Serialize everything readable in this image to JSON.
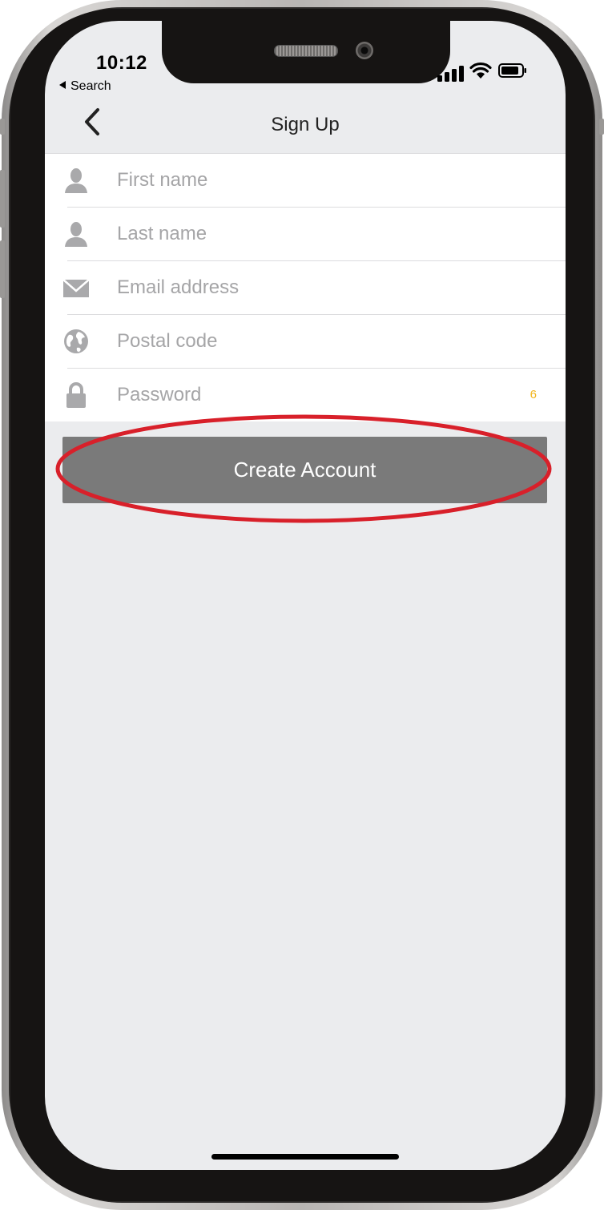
{
  "status_bar": {
    "time": "10:12",
    "back_app_label": "Search",
    "icons": [
      "cellular-signal-icon",
      "wifi-icon",
      "battery-icon"
    ]
  },
  "nav": {
    "title": "Sign Up",
    "back_icon": "chevron-left-icon"
  },
  "form": {
    "fields": [
      {
        "icon": "person-icon",
        "placeholder": "First name",
        "value": ""
      },
      {
        "icon": "person-icon",
        "placeholder": "Last name",
        "value": ""
      },
      {
        "icon": "envelope-icon",
        "placeholder": "Email address",
        "value": ""
      },
      {
        "icon": "globe-icon",
        "placeholder": "Postal code",
        "value": ""
      },
      {
        "icon": "lock-icon",
        "placeholder": "Password",
        "value": "",
        "counter": "6"
      }
    ]
  },
  "actions": {
    "create_account_label": "Create Account"
  },
  "colors": {
    "screen_bg": "#ebecee",
    "button_bg": "#7a7a7a",
    "highlight_ring": "#d8202a",
    "counter": "#f2b51d",
    "placeholder": "#a5a5a7"
  }
}
